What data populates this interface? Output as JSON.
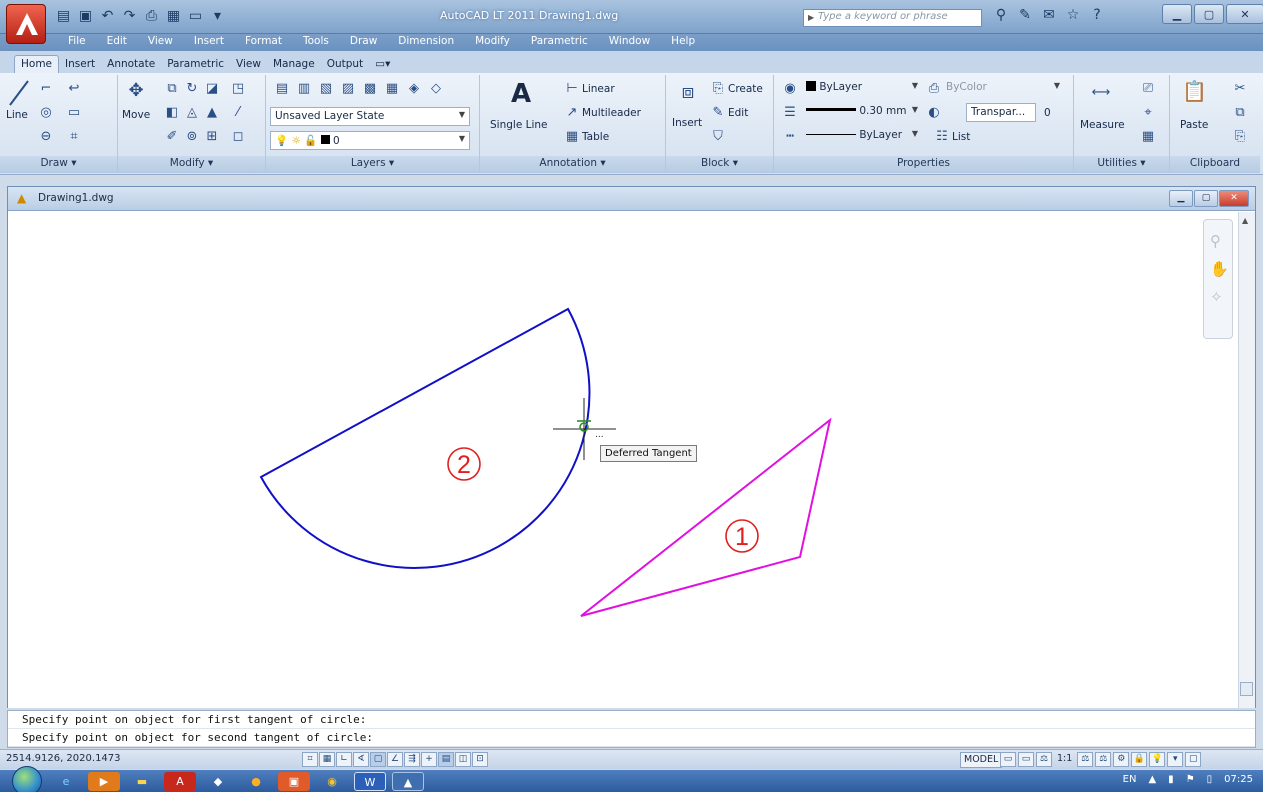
{
  "window": {
    "title": "AutoCAD LT 2011  Drawing1.dwg",
    "search_placeholder": "Type a keyword or phrase"
  },
  "menu": [
    "File",
    "Edit",
    "View",
    "Insert",
    "Format",
    "Tools",
    "Draw",
    "Dimension",
    "Modify",
    "Parametric",
    "Window",
    "Help"
  ],
  "ribbon_tabs": [
    "Home",
    "Insert",
    "Annotate",
    "Parametric",
    "View",
    "Manage",
    "Output"
  ],
  "ribbon": {
    "draw": {
      "title": "Draw",
      "line_label": "Line"
    },
    "modify": {
      "title": "Modify",
      "move_label": "Move"
    },
    "layers": {
      "title": "Layers",
      "layer_state": "Unsaved Layer State",
      "current_layer": "0"
    },
    "annotation": {
      "title": "Annotation",
      "single_line": "Single Line",
      "linear": "Linear",
      "multileader": "Multileader",
      "table": "Table"
    },
    "block": {
      "title": "Block",
      "insert": "Insert",
      "create": "Create",
      "edit": "Edit"
    },
    "properties": {
      "title": "Properties",
      "color": "ByLayer",
      "plot_style": "ByColor",
      "lineweight": "0.30 mm",
      "transparency": "Transpar...",
      "transparency_value": "0",
      "linetype": "ByLayer",
      "list": "List"
    },
    "utilities": {
      "title": "Utilities",
      "measure": "Measure"
    },
    "clipboard": {
      "title": "Clipboard",
      "paste": "Paste"
    }
  },
  "document": {
    "title": "Drawing1.dwg",
    "tooltip": "Deferred Tangent",
    "label_1": "1",
    "label_2": "2",
    "colors": {
      "semicircle": "#1010c8",
      "triangle": "#e010e0",
      "labels": "#e02020",
      "cursor": "#2e8b2e"
    }
  },
  "command_line": [
    "Specify point on object for first tangent of circle:",
    "Specify point on object for second tangent of circle:"
  ],
  "status": {
    "coords": "2514.9126, 2020.1473",
    "model": "MODEL",
    "scale": "1:1"
  },
  "taskbar": {
    "lang": "EN",
    "time": "07:25"
  }
}
